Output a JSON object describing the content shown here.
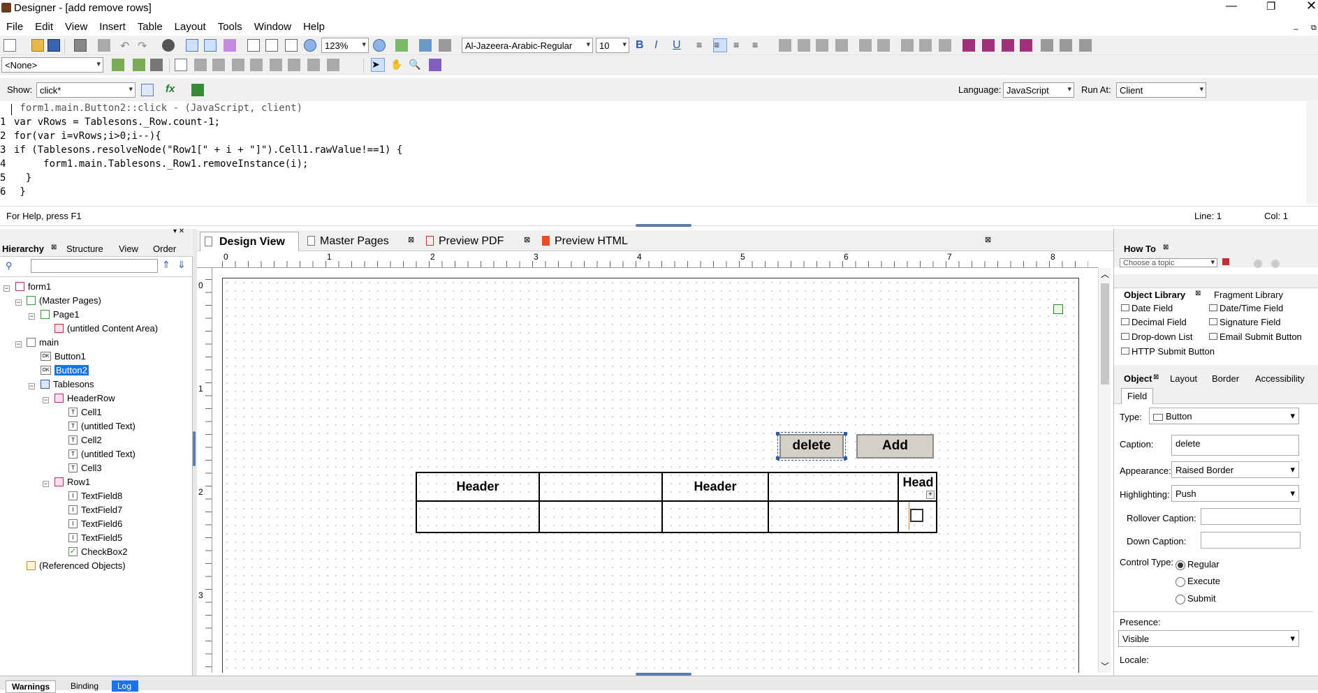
{
  "window": {
    "title": "Designer - [add remove rows]"
  },
  "menu": [
    "File",
    "Edit",
    "View",
    "Insert",
    "Table",
    "Layout",
    "Tools",
    "Window",
    "Help"
  ],
  "toolbar": {
    "zoom": "123%",
    "font": "Al-Jazeera-Arabic-Regular",
    "size": "10",
    "style_select": "<None>"
  },
  "script": {
    "show_label": "Show:",
    "show_value": "click*",
    "language_label": "Language:",
    "language_value": "JavaScript",
    "runat_label": "Run At:",
    "runat_value": "Client",
    "header": " form1.main.Button2::click - (JavaScript, client)",
    "lines": [
      {
        "n": "1",
        "text": "var vRows = Tablesons._Row.count-1;"
      },
      {
        "n": "2",
        "text": "for(var i=vRows;i>0;i--){"
      },
      {
        "n": "3",
        "text": "if (Tablesons.resolveNode(\"Row1[\" + i + \"]\").Cell1.rawValue!==1) {"
      },
      {
        "n": "4",
        "text": "     form1.main.Tablesons._Row1.removeInstance(i);"
      },
      {
        "n": "5",
        "text": "  }"
      },
      {
        "n": "6",
        "text": " }"
      }
    ]
  },
  "status": {
    "help": "For Help, press F1",
    "line": "Line: 1",
    "col": "Col: 1"
  },
  "left_tabs": [
    "Hierarchy",
    "Structure",
    "View",
    "Order"
  ],
  "tree": [
    {
      "label": "form1",
      "level": 0
    },
    {
      "label": "(Master Pages)",
      "level": 1
    },
    {
      "label": "Page1",
      "level": 2
    },
    {
      "label": "(untitled Content Area)",
      "level": 3
    },
    {
      "label": "main",
      "level": 1
    },
    {
      "label": "Button1",
      "level": 2
    },
    {
      "label": "Button2",
      "level": 2
    },
    {
      "label": "Tablesons",
      "level": 2
    },
    {
      "label": "HeaderRow",
      "level": 3
    },
    {
      "label": "Cell1",
      "level": 4
    },
    {
      "label": "(untitled Text)",
      "level": 4
    },
    {
      "label": "Cell2",
      "level": 4
    },
    {
      "label": "(untitled Text)",
      "level": 4
    },
    {
      "label": "Cell3",
      "level": 4
    },
    {
      "label": "Row1",
      "level": 3
    },
    {
      "label": "TextField8",
      "level": 4
    },
    {
      "label": "TextField7",
      "level": 4
    },
    {
      "label": "TextField6",
      "level": 4
    },
    {
      "label": "TextField5",
      "level": 4
    },
    {
      "label": "CheckBox2",
      "level": 4
    },
    {
      "label": "(Referenced Objects)",
      "level": 1
    }
  ],
  "doc_tabs": [
    "Design View",
    "Master Pages",
    "Preview PDF",
    "Preview HTML"
  ],
  "ruler": [
    "0",
    "1",
    "2",
    "3",
    "4",
    "5",
    "6",
    "7",
    "8"
  ],
  "vruler": [
    "0",
    "1",
    "2",
    "3"
  ],
  "design": {
    "delete_label": "delete",
    "add_label": "Add",
    "header1": "Header",
    "header2": "Header",
    "header3": "Head"
  },
  "howto": {
    "title": "How To",
    "select": "Choose a topic"
  },
  "library": {
    "tabs": [
      "Object Library",
      "Fragment Library"
    ],
    "items": [
      "Date Field",
      "Date/Time Field",
      "Decimal Field",
      "Signature Field",
      "Drop-down List",
      "Email Submit Button",
      "HTTP Submit Button"
    ]
  },
  "object": {
    "tabs": [
      "Object",
      "Layout",
      "Border",
      "Accessibility"
    ],
    "subtab": "Field",
    "type_label": "Type:",
    "type_value": "Button",
    "caption_label": "Caption:",
    "caption_value": "delete",
    "appearance_label": "Appearance:",
    "appearance_value": "Raised Border",
    "highlighting_label": "Highlighting:",
    "highlighting_value": "Push",
    "rollover_label": "Rollover Caption:",
    "down_label": "Down Caption:",
    "control_label": "Control Type:",
    "control_options": [
      "Regular",
      "Execute",
      "Submit"
    ],
    "presence_label": "Presence:",
    "presence_value": "Visible",
    "locale_label": "Locale:"
  },
  "bottom_tabs": [
    "Warnings",
    "Binding",
    "Log"
  ]
}
